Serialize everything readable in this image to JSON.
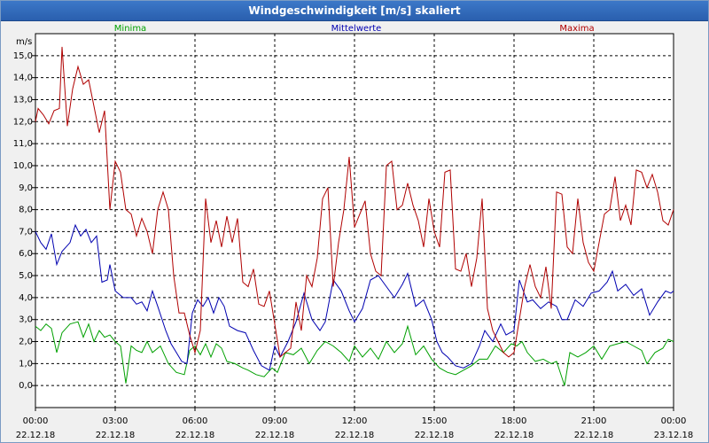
{
  "window": {
    "title": "Windgeschwindigkeit [m/s] skaliert"
  },
  "chart_data": {
    "type": "line",
    "title": "Windgeschwindigkeit [m/s] skaliert",
    "ylabel": "m/s",
    "xlabel": "",
    "ylim": [
      -1.0,
      16.0
    ],
    "xlim": [
      0,
      24
    ],
    "grid": true,
    "legend_placement": "top",
    "yticks": [
      "0,0",
      "1,0",
      "2,0",
      "3,0",
      "4,0",
      "5,0",
      "6,0",
      "7,0",
      "8,0",
      "9,0",
      "10,0",
      "11,0",
      "12,0",
      "13,0",
      "14,0",
      "15,0"
    ],
    "xticks": [
      {
        "time": "00:00",
        "date": "22.12.18"
      },
      {
        "time": "03:00",
        "date": "22.12.18"
      },
      {
        "time": "06:00",
        "date": "22.12.18"
      },
      {
        "time": "09:00",
        "date": "22.12.18"
      },
      {
        "time": "12:00",
        "date": "22.12.18"
      },
      {
        "time": "15:00",
        "date": "22.12.18"
      },
      {
        "time": "18:00",
        "date": "22.12.18"
      },
      {
        "time": "21:00",
        "date": "22.12.18"
      },
      {
        "time": "00:00",
        "date": "23.12.18"
      }
    ],
    "series": [
      {
        "name": "Minima",
        "color": "#00a000",
        "points": [
          [
            0,
            2.7
          ],
          [
            0.2,
            2.5
          ],
          [
            0.4,
            2.8
          ],
          [
            0.6,
            2.6
          ],
          [
            0.8,
            1.5
          ],
          [
            1.0,
            2.4
          ],
          [
            1.3,
            2.8
          ],
          [
            1.6,
            2.9
          ],
          [
            1.8,
            2.2
          ],
          [
            2.0,
            2.8
          ],
          [
            2.2,
            2.0
          ],
          [
            2.4,
            2.5
          ],
          [
            2.6,
            2.2
          ],
          [
            2.8,
            2.3
          ],
          [
            3.0,
            2.0
          ],
          [
            3.2,
            1.8
          ],
          [
            3.4,
            0.1
          ],
          [
            3.6,
            1.8
          ],
          [
            3.8,
            1.6
          ],
          [
            4.0,
            1.5
          ],
          [
            4.2,
            2.0
          ],
          [
            4.4,
            1.5
          ],
          [
            4.7,
            1.8
          ],
          [
            5.0,
            1.0
          ],
          [
            5.3,
            0.6
          ],
          [
            5.6,
            0.5
          ],
          [
            5.8,
            1.6
          ],
          [
            6.0,
            1.8
          ],
          [
            6.2,
            1.4
          ],
          [
            6.4,
            1.9
          ],
          [
            6.6,
            1.3
          ],
          [
            6.8,
            1.9
          ],
          [
            7.0,
            1.7
          ],
          [
            7.2,
            1.1
          ],
          [
            7.5,
            1.0
          ],
          [
            7.8,
            0.8
          ],
          [
            8.0,
            0.7
          ],
          [
            8.3,
            0.5
          ],
          [
            8.6,
            0.4
          ],
          [
            8.9,
            0.8
          ],
          [
            9.1,
            0.6
          ],
          [
            9.4,
            1.5
          ],
          [
            9.7,
            1.4
          ],
          [
            10.0,
            1.7
          ],
          [
            10.3,
            1.0
          ],
          [
            10.6,
            1.6
          ],
          [
            10.9,
            2.0
          ],
          [
            11.2,
            1.8
          ],
          [
            11.5,
            1.5
          ],
          [
            11.8,
            1.1
          ],
          [
            12.0,
            1.8
          ],
          [
            12.3,
            1.3
          ],
          [
            12.6,
            1.7
          ],
          [
            12.9,
            1.2
          ],
          [
            13.2,
            2.0
          ],
          [
            13.5,
            1.5
          ],
          [
            13.8,
            1.9
          ],
          [
            14.0,
            2.7
          ],
          [
            14.3,
            1.4
          ],
          [
            14.6,
            1.8
          ],
          [
            14.9,
            1.2
          ],
          [
            15.2,
            0.8
          ],
          [
            15.5,
            0.6
          ],
          [
            15.8,
            0.5
          ],
          [
            16.1,
            0.7
          ],
          [
            16.4,
            0.9
          ],
          [
            16.7,
            1.2
          ],
          [
            17.0,
            1.2
          ],
          [
            17.3,
            1.8
          ],
          [
            17.6,
            1.5
          ],
          [
            17.9,
            1.9
          ],
          [
            18.1,
            1.8
          ],
          [
            18.3,
            2.0
          ],
          [
            18.5,
            1.5
          ],
          [
            18.8,
            1.1
          ],
          [
            19.1,
            1.2
          ],
          [
            19.4,
            1.0
          ],
          [
            19.6,
            1.1
          ],
          [
            19.9,
            0.0
          ],
          [
            20.1,
            1.5
          ],
          [
            20.4,
            1.3
          ],
          [
            20.7,
            1.5
          ],
          [
            21.0,
            1.8
          ],
          [
            21.3,
            1.2
          ],
          [
            21.6,
            1.8
          ],
          [
            21.9,
            1.9
          ],
          [
            22.2,
            2.0
          ],
          [
            22.5,
            1.8
          ],
          [
            22.8,
            1.6
          ],
          [
            23.0,
            1.0
          ],
          [
            23.3,
            1.5
          ],
          [
            23.6,
            1.7
          ],
          [
            23.8,
            2.1
          ],
          [
            24.0,
            2.0
          ]
        ]
      },
      {
        "name": "Mittelwerte",
        "color": "#0000b0",
        "points": [
          [
            0,
            7.0
          ],
          [
            0.2,
            6.5
          ],
          [
            0.4,
            6.2
          ],
          [
            0.6,
            6.9
          ],
          [
            0.8,
            5.5
          ],
          [
            1.0,
            6.1
          ],
          [
            1.3,
            6.5
          ],
          [
            1.5,
            7.3
          ],
          [
            1.7,
            6.8
          ],
          [
            1.9,
            7.1
          ],
          [
            2.1,
            6.5
          ],
          [
            2.3,
            6.8
          ],
          [
            2.5,
            4.7
          ],
          [
            2.7,
            4.8
          ],
          [
            2.8,
            5.5
          ],
          [
            3.0,
            4.3
          ],
          [
            3.3,
            4.0
          ],
          [
            3.6,
            4.0
          ],
          [
            3.8,
            3.7
          ],
          [
            4.0,
            3.8
          ],
          [
            4.2,
            3.4
          ],
          [
            4.4,
            4.3
          ],
          [
            4.6,
            3.6
          ],
          [
            4.9,
            2.5
          ],
          [
            5.1,
            1.9
          ],
          [
            5.3,
            1.5
          ],
          [
            5.5,
            1.1
          ],
          [
            5.7,
            1.0
          ],
          [
            5.9,
            3.3
          ],
          [
            6.1,
            3.9
          ],
          [
            6.3,
            3.6
          ],
          [
            6.5,
            4.0
          ],
          [
            6.7,
            3.3
          ],
          [
            6.9,
            4.0
          ],
          [
            7.1,
            3.6
          ],
          [
            7.3,
            2.7
          ],
          [
            7.6,
            2.5
          ],
          [
            7.9,
            2.4
          ],
          [
            8.2,
            1.6
          ],
          [
            8.5,
            0.9
          ],
          [
            8.8,
            0.7
          ],
          [
            9.0,
            1.8
          ],
          [
            9.2,
            1.3
          ],
          [
            9.5,
            2.0
          ],
          [
            9.8,
            2.9
          ],
          [
            10.1,
            4.2
          ],
          [
            10.4,
            3.0
          ],
          [
            10.7,
            2.5
          ],
          [
            10.9,
            2.9
          ],
          [
            11.2,
            4.8
          ],
          [
            11.5,
            4.3
          ],
          [
            11.8,
            3.4
          ],
          [
            12.0,
            2.9
          ],
          [
            12.3,
            3.5
          ],
          [
            12.6,
            4.8
          ],
          [
            12.9,
            5.0
          ],
          [
            13.2,
            4.5
          ],
          [
            13.5,
            4.0
          ],
          [
            13.8,
            4.6
          ],
          [
            14.0,
            5.1
          ],
          [
            14.3,
            3.6
          ],
          [
            14.6,
            3.9
          ],
          [
            14.9,
            3.0
          ],
          [
            15.1,
            2.0
          ],
          [
            15.3,
            1.5
          ],
          [
            15.5,
            1.3
          ],
          [
            15.8,
            0.9
          ],
          [
            16.1,
            0.8
          ],
          [
            16.4,
            1.0
          ],
          [
            16.7,
            1.8
          ],
          [
            16.9,
            2.5
          ],
          [
            17.2,
            2.0
          ],
          [
            17.5,
            2.8
          ],
          [
            17.7,
            2.3
          ],
          [
            18.0,
            2.5
          ],
          [
            18.2,
            4.8
          ],
          [
            18.5,
            3.8
          ],
          [
            18.7,
            3.9
          ],
          [
            19.0,
            3.5
          ],
          [
            19.3,
            3.8
          ],
          [
            19.6,
            3.6
          ],
          [
            19.8,
            3.0
          ],
          [
            20.0,
            3.0
          ],
          [
            20.3,
            3.9
          ],
          [
            20.6,
            3.6
          ],
          [
            20.9,
            4.2
          ],
          [
            21.2,
            4.3
          ],
          [
            21.5,
            4.7
          ],
          [
            21.7,
            5.2
          ],
          [
            21.9,
            4.3
          ],
          [
            22.2,
            4.6
          ],
          [
            22.5,
            4.1
          ],
          [
            22.8,
            4.4
          ],
          [
            23.1,
            3.2
          ],
          [
            23.4,
            3.8
          ],
          [
            23.7,
            4.3
          ],
          [
            23.9,
            4.2
          ],
          [
            24.0,
            4.3
          ]
        ]
      },
      {
        "name": "Maxima",
        "color": "#b00000",
        "points": [
          [
            0,
            12.0
          ],
          [
            0.1,
            12.6
          ],
          [
            0.3,
            12.3
          ],
          [
            0.5,
            11.9
          ],
          [
            0.7,
            12.5
          ],
          [
            0.9,
            12.6
          ],
          [
            1.0,
            15.4
          ],
          [
            1.2,
            11.8
          ],
          [
            1.4,
            13.5
          ],
          [
            1.6,
            14.5
          ],
          [
            1.8,
            13.7
          ],
          [
            2.0,
            13.9
          ],
          [
            2.2,
            12.7
          ],
          [
            2.4,
            11.5
          ],
          [
            2.6,
            12.5
          ],
          [
            2.8,
            8.0
          ],
          [
            3.0,
            10.2
          ],
          [
            3.2,
            9.7
          ],
          [
            3.4,
            8.0
          ],
          [
            3.6,
            7.8
          ],
          [
            3.8,
            6.8
          ],
          [
            4.0,
            7.6
          ],
          [
            4.2,
            7.0
          ],
          [
            4.4,
            6.0
          ],
          [
            4.6,
            8.0
          ],
          [
            4.8,
            8.8
          ],
          [
            5.0,
            8.0
          ],
          [
            5.2,
            5.0
          ],
          [
            5.4,
            3.3
          ],
          [
            5.6,
            3.3
          ],
          [
            5.8,
            2.3
          ],
          [
            6.0,
            1.5
          ],
          [
            6.2,
            2.5
          ],
          [
            6.4,
            8.5
          ],
          [
            6.6,
            6.5
          ],
          [
            6.8,
            7.5
          ],
          [
            7.0,
            6.3
          ],
          [
            7.2,
            7.7
          ],
          [
            7.4,
            6.5
          ],
          [
            7.6,
            7.6
          ],
          [
            7.8,
            4.7
          ],
          [
            8.0,
            4.5
          ],
          [
            8.2,
            5.3
          ],
          [
            8.4,
            3.7
          ],
          [
            8.6,
            3.6
          ],
          [
            8.8,
            4.3
          ],
          [
            9.0,
            2.8
          ],
          [
            9.2,
            1.3
          ],
          [
            9.4,
            1.5
          ],
          [
            9.6,
            1.7
          ],
          [
            9.8,
            3.8
          ],
          [
            10.0,
            2.5
          ],
          [
            10.2,
            5.0
          ],
          [
            10.4,
            4.5
          ],
          [
            10.6,
            5.8
          ],
          [
            10.8,
            8.5
          ],
          [
            11.0,
            9.0
          ],
          [
            11.2,
            4.5
          ],
          [
            11.4,
            6.5
          ],
          [
            11.6,
            8.0
          ],
          [
            11.8,
            10.4
          ],
          [
            12.0,
            7.2
          ],
          [
            12.2,
            7.8
          ],
          [
            12.4,
            8.4
          ],
          [
            12.6,
            6.0
          ],
          [
            12.8,
            5.2
          ],
          [
            13.0,
            5.0
          ],
          [
            13.2,
            10.0
          ],
          [
            13.4,
            10.2
          ],
          [
            13.6,
            8.0
          ],
          [
            13.8,
            8.2
          ],
          [
            14.0,
            9.2
          ],
          [
            14.2,
            8.2
          ],
          [
            14.4,
            7.5
          ],
          [
            14.6,
            6.3
          ],
          [
            14.8,
            8.5
          ],
          [
            15.0,
            7.0
          ],
          [
            15.2,
            6.3
          ],
          [
            15.4,
            9.7
          ],
          [
            15.6,
            9.8
          ],
          [
            15.8,
            5.3
          ],
          [
            16.0,
            5.2
          ],
          [
            16.2,
            6.0
          ],
          [
            16.4,
            4.5
          ],
          [
            16.6,
            5.8
          ],
          [
            16.8,
            8.5
          ],
          [
            17.0,
            3.5
          ],
          [
            17.2,
            2.5
          ],
          [
            17.4,
            2.0
          ],
          [
            17.6,
            1.5
          ],
          [
            17.8,
            1.3
          ],
          [
            18.0,
            1.5
          ],
          [
            18.2,
            3.0
          ],
          [
            18.4,
            4.5
          ],
          [
            18.6,
            5.5
          ],
          [
            18.8,
            4.5
          ],
          [
            19.0,
            4.0
          ],
          [
            19.2,
            5.4
          ],
          [
            19.4,
            3.5
          ],
          [
            19.6,
            8.8
          ],
          [
            19.8,
            8.7
          ],
          [
            20.0,
            6.3
          ],
          [
            20.2,
            6.0
          ],
          [
            20.4,
            8.5
          ],
          [
            20.6,
            6.5
          ],
          [
            20.8,
            5.6
          ],
          [
            21.0,
            5.2
          ],
          [
            21.2,
            6.5
          ],
          [
            21.4,
            7.8
          ],
          [
            21.6,
            8.0
          ],
          [
            21.8,
            9.5
          ],
          [
            22.0,
            7.5
          ],
          [
            22.2,
            8.2
          ],
          [
            22.4,
            7.3
          ],
          [
            22.6,
            9.8
          ],
          [
            22.8,
            9.7
          ],
          [
            23.0,
            9.0
          ],
          [
            23.2,
            9.6
          ],
          [
            23.4,
            8.8
          ],
          [
            23.6,
            7.5
          ],
          [
            23.8,
            7.3
          ],
          [
            24.0,
            8.0
          ]
        ]
      }
    ]
  }
}
